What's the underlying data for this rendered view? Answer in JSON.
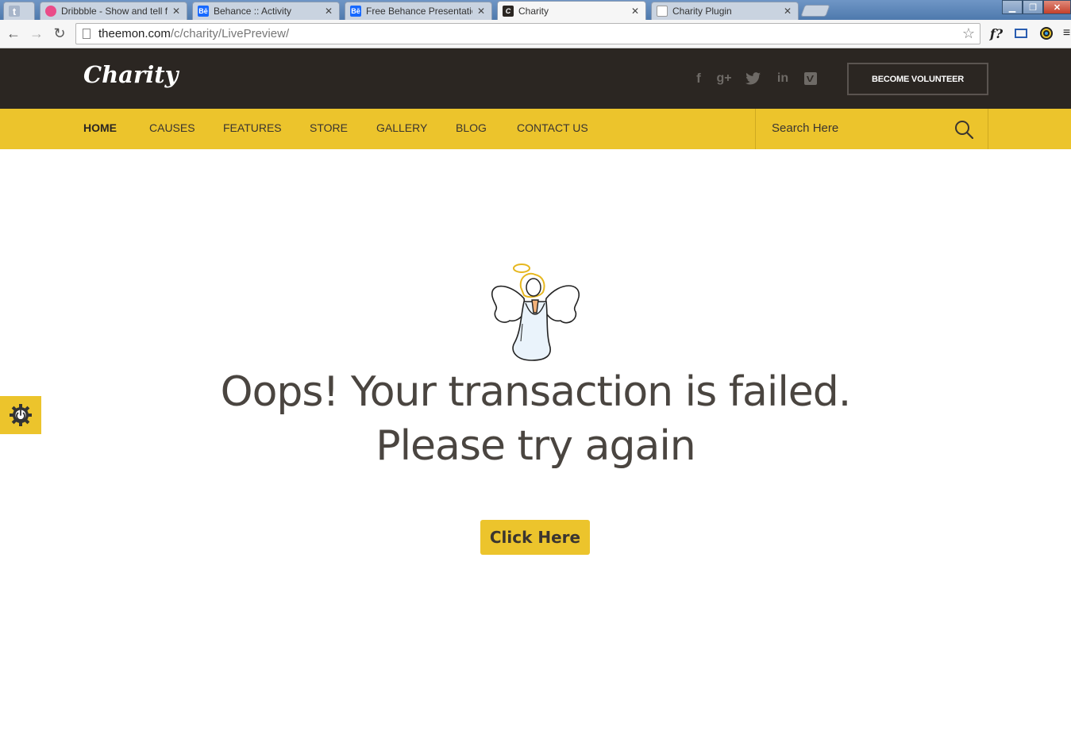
{
  "browser": {
    "tabs": [
      {
        "label": "",
        "favicon": "tumblr-icon"
      },
      {
        "label": "Dribbble - Show and tell fo",
        "favicon": "dribbble-icon"
      },
      {
        "label": "Behance :: Activity",
        "favicon": "behance-icon"
      },
      {
        "label": "Free Behance Presentation",
        "favicon": "behance-icon"
      },
      {
        "label": "Charity",
        "favicon": "charity-icon",
        "active": true
      },
      {
        "label": "Charity Plugin",
        "favicon": "page-icon"
      }
    ],
    "url_host": "theemon.com",
    "url_path": "/c/charity/LivePreview/"
  },
  "header": {
    "logo": "Charity",
    "social_icons": [
      "facebook-icon",
      "google-plus-icon",
      "twitter-icon",
      "linkedin-icon",
      "vimeo-icon"
    ],
    "volunteer_label": "BECOME VOLUNTEER"
  },
  "nav": {
    "items": [
      "HOME",
      "CAUSES",
      "FEATURES",
      "STORE",
      "GALLERY",
      "BLOG",
      "CONTACT US"
    ],
    "search_placeholder": "Search Here"
  },
  "main": {
    "title_line1": "Oops! Your transaction is failed.",
    "title_line2": "Please try again",
    "button_label": "Click Here"
  },
  "colors": {
    "header_bg": "#2b2622",
    "accent_yellow": "#ecc42c",
    "text_dark": "#4a4540"
  }
}
